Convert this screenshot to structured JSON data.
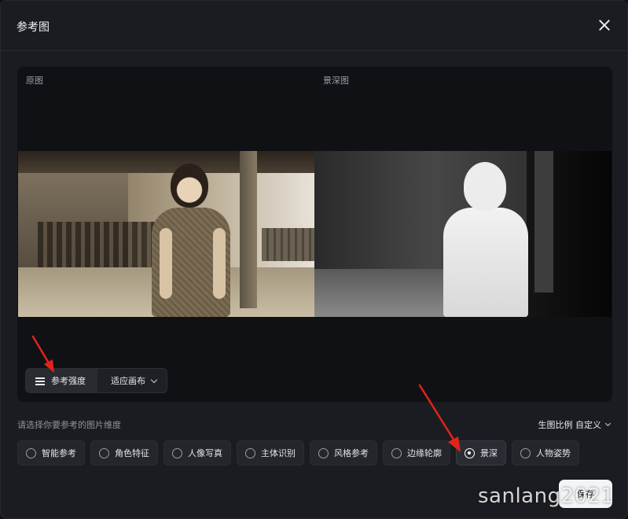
{
  "dialog": {
    "title": "参考图",
    "close_icon": "close-icon"
  },
  "preview": {
    "original_label": "原图",
    "depth_label": "景深图"
  },
  "controls": {
    "strength_label": "参考强度",
    "fit_label": "适应画布"
  },
  "dimension": {
    "prompt": "请选择你要参考的图片维度",
    "ratio_label": "生图比例 自定义"
  },
  "options": [
    {
      "label": "智能参考",
      "selected": false
    },
    {
      "label": "角色特征",
      "selected": false
    },
    {
      "label": "人像写真",
      "selected": false
    },
    {
      "label": "主体识别",
      "selected": false
    },
    {
      "label": "风格参考",
      "selected": false
    },
    {
      "label": "边缘轮廓",
      "selected": false
    },
    {
      "label": "景深",
      "selected": true
    },
    {
      "label": "人物姿势",
      "selected": false
    }
  ],
  "footer": {
    "save_label": "保存"
  },
  "watermark": "sanlang2021",
  "colors": {
    "background": "#1b1c21",
    "panel": "#101115",
    "annotation_arrow": "#e2231a"
  }
}
